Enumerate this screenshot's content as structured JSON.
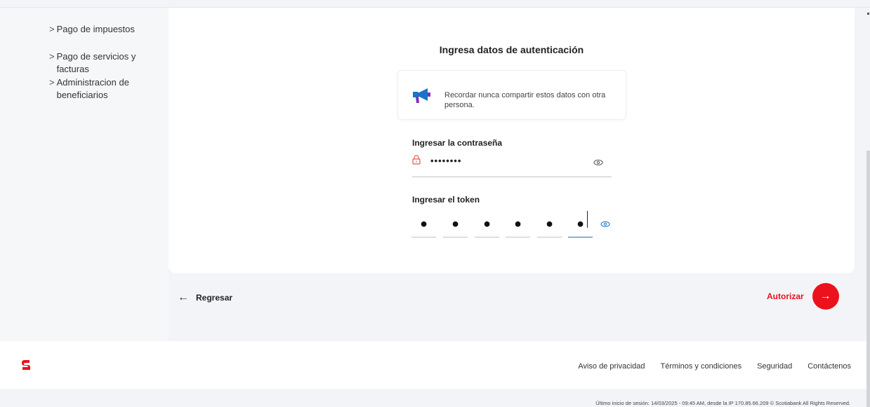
{
  "sidebar": {
    "items": [
      {
        "label": "Pago de impuestos"
      },
      {
        "label": "Pago de servicios y facturas"
      },
      {
        "label": "Administracion de beneficiarios"
      }
    ],
    "chevron": ">"
  },
  "auth": {
    "title": "Ingresa datos de autenticación",
    "notice": "Recordar nunca compartir estos datos con otra persona.",
    "password_label": "Ingresar la contraseña",
    "password_value": "••••••••",
    "token_label": "Ingresar el token",
    "token_digits": [
      "●",
      "●",
      "●",
      "●",
      "●",
      "●"
    ]
  },
  "actions": {
    "back_arrow": "←",
    "back_label": "Regresar",
    "authorize_label": "Autorizar",
    "authorize_arrow": "→"
  },
  "footer": {
    "links": [
      "Aviso de privacidad",
      "Términos y condiciones",
      "Seguridad",
      "Contáctenos"
    ],
    "last_login": "Último inicio de sesión: 14/03/2025 - 09:45 AM, desde la IP 170.85.66.209 © Scotiabank All Rights Reserved."
  },
  "colors": {
    "brand_red": "#ec111a",
    "token_active": "#1a73c9",
    "megaphone_blue": "#1a73c9",
    "megaphone_purple": "#7b2fbf"
  }
}
